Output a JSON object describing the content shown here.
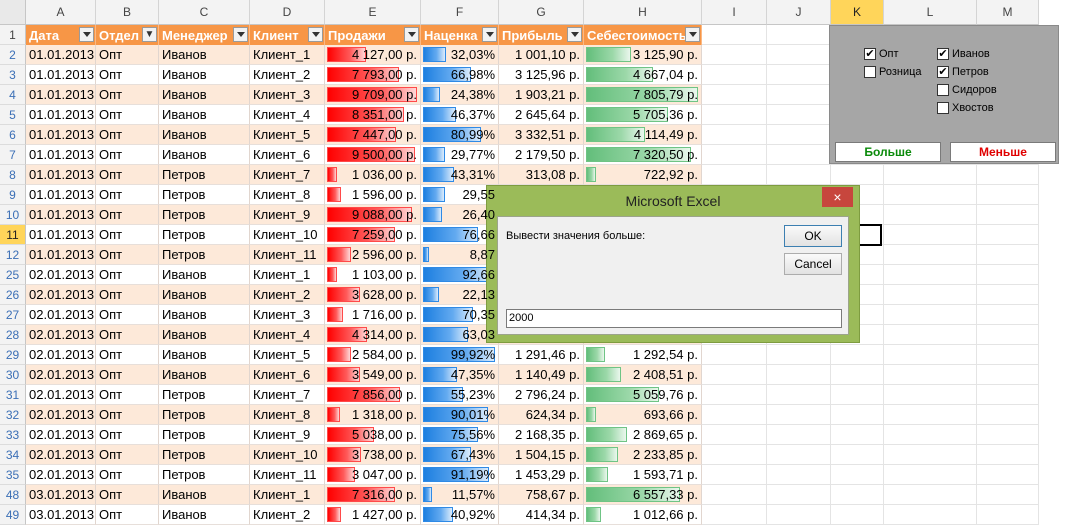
{
  "columns": [
    "A",
    "B",
    "C",
    "D",
    "E",
    "F",
    "G",
    "H",
    "I",
    "J",
    "K",
    "L",
    "M"
  ],
  "selected_column": "K",
  "selected_row": "11",
  "header_row_number": "1",
  "headers": [
    "Дата",
    "Отдел",
    "Менеджер",
    "Клиент",
    "Продажи",
    "Наценка",
    "Прибыль",
    "Себестоимость"
  ],
  "colors": {
    "header_fill": "#f79646",
    "band_fill": "#fde9d9",
    "sales_bar": "#ff0000",
    "margin_bar": "#1d7fe0",
    "cost_bar": "#63be7b",
    "panel_bg": "#a6a6a6",
    "dialog_frame": "#9bbb59"
  },
  "rows": [
    {
      "num": "2",
      "date": "01.01.2013",
      "dept": "Опт",
      "mgr": "Иванов",
      "client": "Клиент_1",
      "sales": "4 127,00 р.",
      "sales_fill": 0.43,
      "margin": "32,03%",
      "margin_fill": 0.32,
      "profit": "1 001,10 р.",
      "cost": "3 125,90 р.",
      "cost_fill": 0.4
    },
    {
      "num": "3",
      "date": "01.01.2013",
      "dept": "Опт",
      "mgr": "Иванов",
      "client": "Клиент_2",
      "sales": "7 793,00 р.",
      "sales_fill": 0.8,
      "margin": "66,98%",
      "margin_fill": 0.67,
      "profit": "3 125,96 р.",
      "cost": "4 667,04 р.",
      "cost_fill": 0.6
    },
    {
      "num": "4",
      "date": "01.01.2013",
      "dept": "Опт",
      "mgr": "Иванов",
      "client": "Клиент_3",
      "sales": "9 709,00 р.",
      "sales_fill": 1.0,
      "margin": "24,38%",
      "margin_fill": 0.24,
      "profit": "1 903,21 р.",
      "cost": "7 805,79 р.",
      "cost_fill": 1.0
    },
    {
      "num": "5",
      "date": "01.01.2013",
      "dept": "Опт",
      "mgr": "Иванов",
      "client": "Клиент_4",
      "sales": "8 351,00 р.",
      "sales_fill": 0.86,
      "margin": "46,37%",
      "margin_fill": 0.46,
      "profit": "2 645,64 р.",
      "cost": "5 705,36 р.",
      "cost_fill": 0.73
    },
    {
      "num": "6",
      "date": "01.01.2013",
      "dept": "Опт",
      "mgr": "Иванов",
      "client": "Клиент_5",
      "sales": "7 447,00 р.",
      "sales_fill": 0.77,
      "margin": "80,99%",
      "margin_fill": 0.81,
      "profit": "3 332,51 р.",
      "cost": "4 114,49 р.",
      "cost_fill": 0.53
    },
    {
      "num": "7",
      "date": "01.01.2013",
      "dept": "Опт",
      "mgr": "Иванов",
      "client": "Клиент_6",
      "sales": "9 500,00 р.",
      "sales_fill": 0.98,
      "margin": "29,77%",
      "margin_fill": 0.3,
      "profit": "2 179,50 р.",
      "cost": "7 320,50 р.",
      "cost_fill": 0.94
    },
    {
      "num": "8",
      "date": "01.01.2013",
      "dept": "Опт",
      "mgr": "Петров",
      "client": "Клиент_7",
      "sales": "1 036,00 р.",
      "sales_fill": 0.11,
      "margin": "43,31%",
      "margin_fill": 0.43,
      "profit": "313,08 р.",
      "cost": "722,92 р.",
      "cost_fill": 0.09
    },
    {
      "num": "9",
      "date": "01.01.2013",
      "dept": "Опт",
      "mgr": "Петров",
      "client": "Клиент_8",
      "sales": "1 596,00 р.",
      "sales_fill": 0.16,
      "margin": "29,55",
      "margin_fill": 0.3,
      "profit": "",
      "cost": "",
      "cost_fill": 0
    },
    {
      "num": "10",
      "date": "01.01.2013",
      "dept": "Опт",
      "mgr": "Петров",
      "client": "Клиент_9",
      "sales": "9 088,00 р.",
      "sales_fill": 0.94,
      "margin": "26,40",
      "margin_fill": 0.26,
      "profit": "",
      "cost": "",
      "cost_fill": 0
    },
    {
      "num": "11",
      "date": "01.01.2013",
      "dept": "Опт",
      "mgr": "Петров",
      "client": "Клиент_10",
      "sales": "7 259,00 р.",
      "sales_fill": 0.75,
      "margin": "76,66",
      "margin_fill": 0.77,
      "profit": "",
      "cost": "",
      "cost_fill": 0
    },
    {
      "num": "12",
      "date": "01.01.2013",
      "dept": "Опт",
      "mgr": "Петров",
      "client": "Клиент_11",
      "sales": "2 596,00 р.",
      "sales_fill": 0.27,
      "margin": "8,87",
      "margin_fill": 0.09,
      "profit": "",
      "cost": "",
      "cost_fill": 0
    },
    {
      "num": "25",
      "date": "02.01.2013",
      "dept": "Опт",
      "mgr": "Иванов",
      "client": "Клиент_1",
      "sales": "1 103,00 р.",
      "sales_fill": 0.11,
      "margin": "92,66",
      "margin_fill": 0.93,
      "profit": "",
      "cost": "",
      "cost_fill": 0
    },
    {
      "num": "26",
      "date": "02.01.2013",
      "dept": "Опт",
      "mgr": "Иванов",
      "client": "Клиент_2",
      "sales": "3 628,00 р.",
      "sales_fill": 0.37,
      "margin": "22,13",
      "margin_fill": 0.22,
      "profit": "",
      "cost": "",
      "cost_fill": 0
    },
    {
      "num": "27",
      "date": "02.01.2013",
      "dept": "Опт",
      "mgr": "Иванов",
      "client": "Клиент_3",
      "sales": "1 716,00 р.",
      "sales_fill": 0.18,
      "margin": "70,35",
      "margin_fill": 0.7,
      "profit": "",
      "cost": "",
      "cost_fill": 0
    },
    {
      "num": "28",
      "date": "02.01.2013",
      "dept": "Опт",
      "mgr": "Иванов",
      "client": "Клиент_4",
      "sales": "4 314,00 р.",
      "sales_fill": 0.44,
      "margin": "63,03",
      "margin_fill": 0.63,
      "profit": "",
      "cost": "",
      "cost_fill": 0
    },
    {
      "num": "29",
      "date": "02.01.2013",
      "dept": "Опт",
      "mgr": "Иванов",
      "client": "Клиент_5",
      "sales": "2 584,00 р.",
      "sales_fill": 0.27,
      "margin": "99,92%",
      "margin_fill": 1.0,
      "profit": "1 291,46 р.",
      "cost": "1 292,54 р.",
      "cost_fill": 0.17
    },
    {
      "num": "30",
      "date": "02.01.2013",
      "dept": "Опт",
      "mgr": "Иванов",
      "client": "Клиент_6",
      "sales": "3 549,00 р.",
      "sales_fill": 0.37,
      "margin": "47,35%",
      "margin_fill": 0.47,
      "profit": "1 140,49 р.",
      "cost": "2 408,51 р.",
      "cost_fill": 0.31
    },
    {
      "num": "31",
      "date": "02.01.2013",
      "dept": "Опт",
      "mgr": "Петров",
      "client": "Клиент_7",
      "sales": "7 856,00 р.",
      "sales_fill": 0.81,
      "margin": "55,23%",
      "margin_fill": 0.55,
      "profit": "2 796,24 р.",
      "cost": "5 059,76 р.",
      "cost_fill": 0.65
    },
    {
      "num": "32",
      "date": "02.01.2013",
      "dept": "Опт",
      "mgr": "Петров",
      "client": "Клиент_8",
      "sales": "1 318,00 р.",
      "sales_fill": 0.14,
      "margin": "90,01%",
      "margin_fill": 0.9,
      "profit": "624,34 р.",
      "cost": "693,66 р.",
      "cost_fill": 0.09
    },
    {
      "num": "33",
      "date": "02.01.2013",
      "dept": "Опт",
      "mgr": "Петров",
      "client": "Клиент_9",
      "sales": "5 038,00 р.",
      "sales_fill": 0.52,
      "margin": "75,56%",
      "margin_fill": 0.76,
      "profit": "2 168,35 р.",
      "cost": "2 869,65 р.",
      "cost_fill": 0.37
    },
    {
      "num": "34",
      "date": "02.01.2013",
      "dept": "Опт",
      "mgr": "Петров",
      "client": "Клиент_10",
      "sales": "3 738,00 р.",
      "sales_fill": 0.38,
      "margin": "67,43%",
      "margin_fill": 0.67,
      "profit": "1 504,15 р.",
      "cost": "2 233,85 р.",
      "cost_fill": 0.29
    },
    {
      "num": "35",
      "date": "02.01.2013",
      "dept": "Опт",
      "mgr": "Петров",
      "client": "Клиент_11",
      "sales": "3 047,00 р.",
      "sales_fill": 0.31,
      "margin": "91,19%",
      "margin_fill": 0.91,
      "profit": "1 453,29 р.",
      "cost": "1 593,71 р.",
      "cost_fill": 0.2
    },
    {
      "num": "48",
      "date": "03.01.2013",
      "dept": "Опт",
      "mgr": "Иванов",
      "client": "Клиент_1",
      "sales": "7 316,00 р.",
      "sales_fill": 0.75,
      "margin": "11,57%",
      "margin_fill": 0.12,
      "profit": "758,67 р.",
      "cost": "6 557,33 р.",
      "cost_fill": 0.84
    },
    {
      "num": "49",
      "date": "03.01.2013",
      "dept": "Опт",
      "mgr": "Иванов",
      "client": "Клиент_2",
      "sales": "1 427,00 р.",
      "sales_fill": 0.15,
      "margin": "40,92%",
      "margin_fill": 0.41,
      "profit": "414,34 р.",
      "cost": "1 012,66 р.",
      "cost_fill": 0.13
    }
  ],
  "panel": {
    "checkboxes": [
      {
        "label": "Опт",
        "checked": true
      },
      {
        "label": "Розница",
        "checked": false
      },
      {
        "label": "Иванов",
        "checked": true
      },
      {
        "label": "Петров",
        "checked": true
      },
      {
        "label": "Сидоров",
        "checked": false
      },
      {
        "label": "Хвостов",
        "checked": false
      }
    ],
    "more_label": "Больше",
    "less_label": "Меньше"
  },
  "dialog": {
    "title": "Microsoft Excel",
    "close_glyph": "×",
    "prompt": "Вывести значения больше:",
    "ok_label": "OK",
    "cancel_label": "Cancel",
    "input_value": "2000"
  }
}
